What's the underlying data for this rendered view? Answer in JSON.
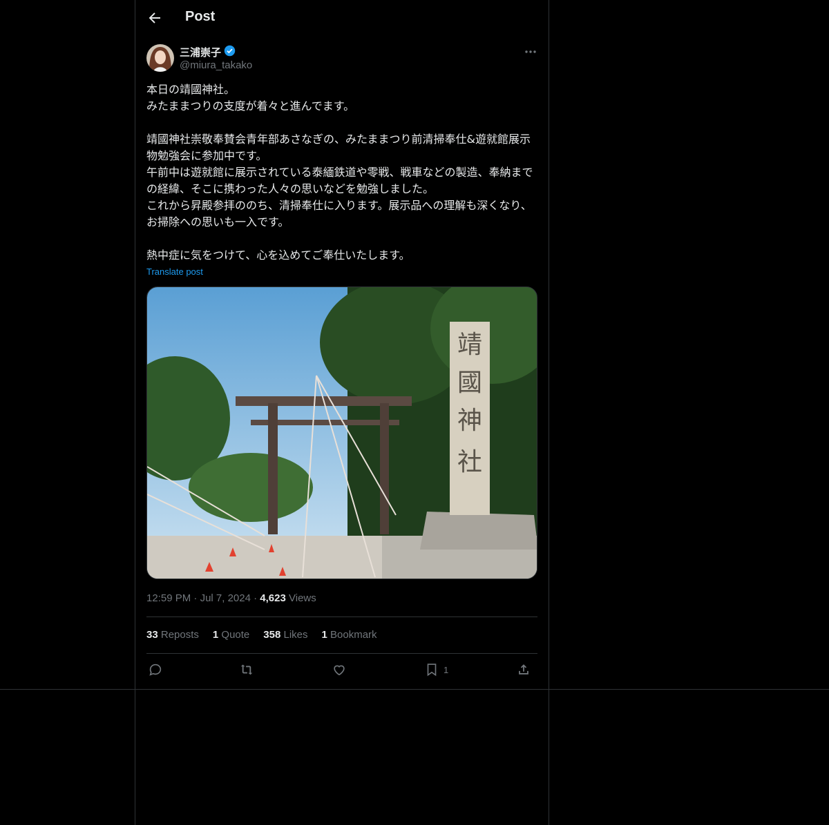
{
  "header": {
    "title": "Post"
  },
  "author": {
    "name": "三浦崇子",
    "handle": "@miura_takako"
  },
  "post": {
    "text": "本日の靖國神社。\nみたままつりの支度が着々と進んでます。\n\n靖國神社崇敬奉賛会青年部あさなぎの、みたままつり前清掃奉仕&遊就館展示物勉強会に参加中です。\n午前中は遊就館に展示されている泰緬鉄道や零戦、戦車などの製造、奉納までの経緯、そこに携わった人々の思いなどを勉強しました。\nこれから昇殿参拝ののち、清掃奉仕に入ります。展示品への理解も深くなり、お掃除への思いも一入です。\n\n熱中症に気をつけて、心を込めてご奉仕いたします。",
    "translate_label": "Translate post",
    "time": "12:59 PM",
    "date": "Jul 7, 2024",
    "views_count": "4,623",
    "views_label": "Views",
    "image_stone_text": "靖國神社"
  },
  "stats": {
    "reposts_count": "33",
    "reposts_label": "Reposts",
    "quotes_count": "1",
    "quotes_label": "Quote",
    "likes_count": "358",
    "likes_label": "Likes",
    "bookmarks_count": "1",
    "bookmarks_label": "Bookmark"
  },
  "actions": {
    "bookmark_count": "1"
  },
  "colors": {
    "accent": "#1d9bf0",
    "muted": "#71767b",
    "border": "#2f3336",
    "background": "#000000"
  }
}
